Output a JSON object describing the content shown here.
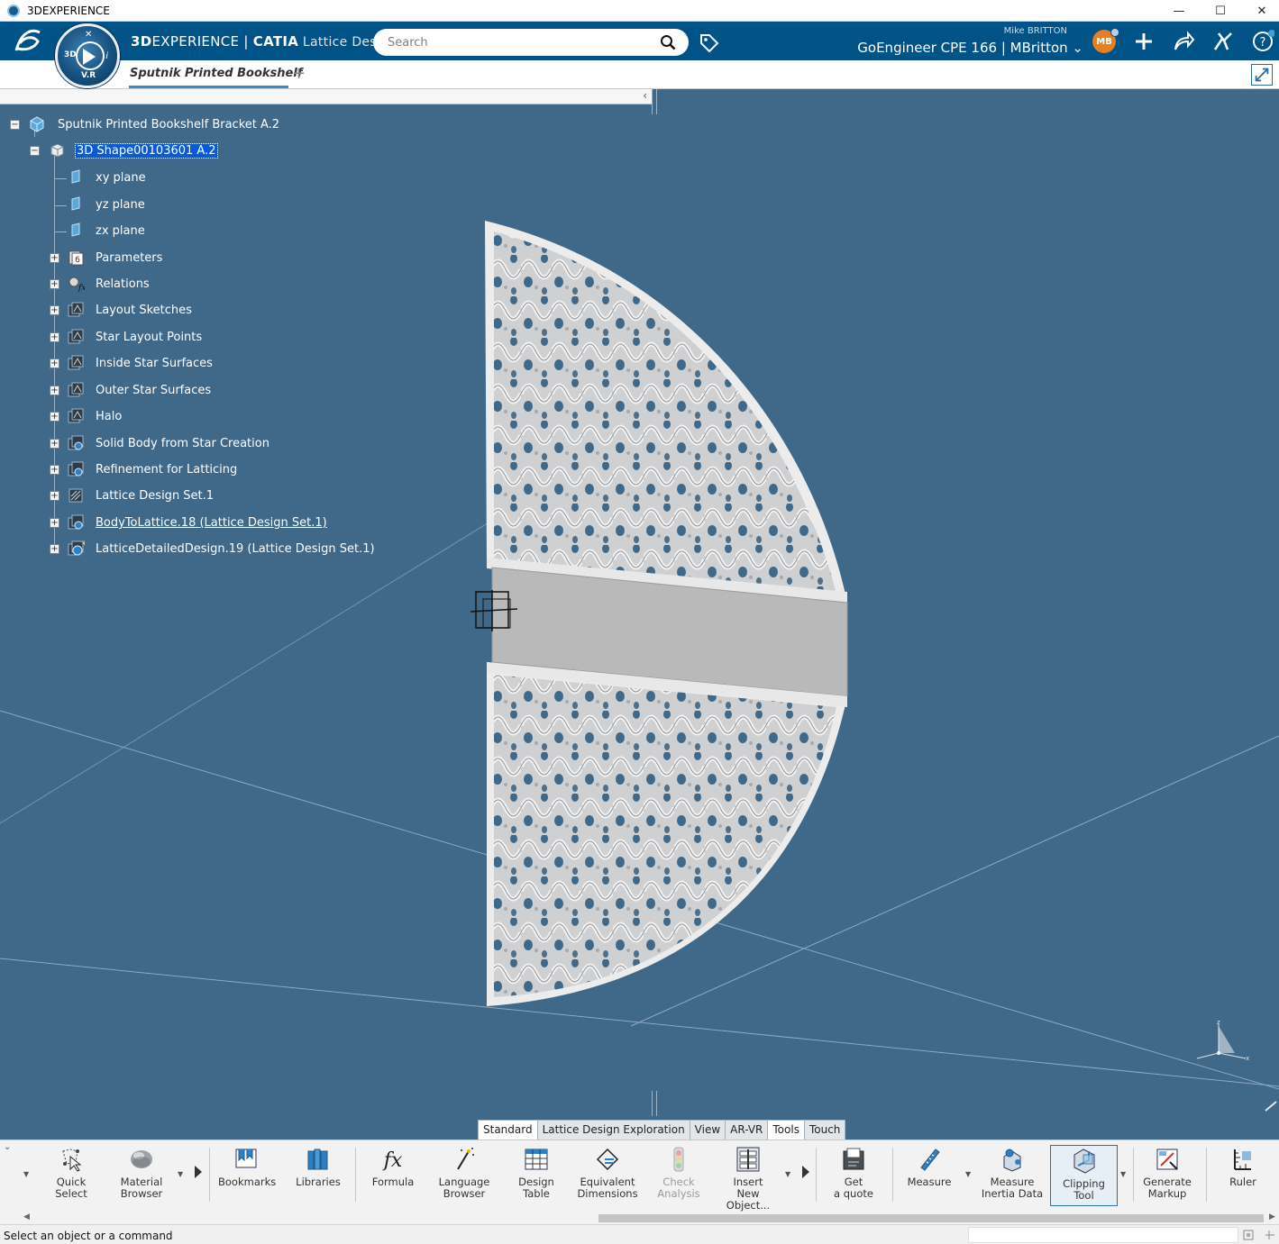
{
  "window": {
    "title": "3DEXPERIENCE",
    "minimize": "—",
    "maximize": "☐",
    "close": "✕"
  },
  "topbar": {
    "compass_3d": "3D",
    "compass_vr": "V.R",
    "brand": "3D",
    "brand_rest": "EXPERIENCE",
    "separator": " | ",
    "product": "CATIA",
    "app": " Lattice Design",
    "search_placeholder": "Search",
    "user_name": "Mike BRITTON",
    "tenant": "GoEngineer CPE 166 | MBritton ⌄",
    "avatar_initials": "MB"
  },
  "tabs": {
    "active": "Sputnik Printed Bookshelf",
    "add": "+"
  },
  "tree": {
    "collapse": "‹",
    "nodes": [
      {
        "label": "Sputnik Printed Bookshelf Bracket A.2",
        "icon": "product-icon"
      },
      {
        "label": "3D Shape00103601 A.2",
        "icon": "part-icon",
        "selected": true
      },
      {
        "label": "xy plane",
        "icon": "plane-icon"
      },
      {
        "label": "yz plane",
        "icon": "plane-icon"
      },
      {
        "label": "zx plane",
        "icon": "plane-icon"
      },
      {
        "label": "Parameters",
        "icon": "parameters-icon"
      },
      {
        "label": "Relations",
        "icon": "relations-icon"
      },
      {
        "label": "Layout Sketches",
        "icon": "geometrical-set-icon"
      },
      {
        "label": "Star Layout Points",
        "icon": "geometrical-set-icon"
      },
      {
        "label": "Inside Star Surfaces",
        "icon": "geometrical-set-icon"
      },
      {
        "label": "Outer Star Surfaces",
        "icon": "geometrical-set-icon"
      },
      {
        "label": "Halo",
        "icon": "geometrical-set-icon"
      },
      {
        "label": "Solid Body from Star Creation",
        "icon": "body-icon"
      },
      {
        "label": "Refinement for Latticing",
        "icon": "body-icon"
      },
      {
        "label": "Lattice Design Set.1",
        "icon": "lattice-set-icon"
      },
      {
        "label": "BodyToLattice.18 (Lattice Design Set.1)",
        "icon": "body-to-lattice-icon",
        "underline": true
      },
      {
        "label": "LatticeDetailedDesign.19 (Lattice Design Set.1)",
        "icon": "lattice-detailed-icon"
      }
    ]
  },
  "section_tabs": [
    "Standard",
    "Lattice Design Exploration",
    "View",
    "AR-VR",
    "Tools",
    "Touch"
  ],
  "actions": [
    {
      "name": "quick-select",
      "label1": "Quick",
      "label2": "Select",
      "icon": "quick-select-icon"
    },
    {
      "name": "material-browser",
      "label1": "Material",
      "label2": "Browser",
      "icon": "material-browser-icon"
    },
    {
      "name": "bookmarks",
      "label1": "Bookmarks",
      "label2": "",
      "icon": "bookmarks-icon"
    },
    {
      "name": "libraries",
      "label1": "Libraries",
      "label2": "",
      "icon": "libraries-icon"
    },
    {
      "name": "formula",
      "label1": "Formula",
      "label2": "",
      "icon": "formula-icon"
    },
    {
      "name": "language-browser",
      "label1": "Language",
      "label2": "Browser",
      "icon": "language-browser-icon"
    },
    {
      "name": "design-table",
      "label1": "Design",
      "label2": "Table",
      "icon": "design-table-icon"
    },
    {
      "name": "equivalent-dimensions",
      "label1": "Equivalent",
      "label2": "Dimensions",
      "icon": "equivalent-dimensions-icon"
    },
    {
      "name": "check-analysis",
      "label1": "Check",
      "label2": "Analysis",
      "icon": "check-analysis-icon",
      "disabled": true
    },
    {
      "name": "insert-new-object",
      "label1": "Insert",
      "label2": "New Object...",
      "icon": "insert-object-icon"
    },
    {
      "name": "get-a-quote",
      "label1": "Get",
      "label2": "a quote",
      "icon": "quote-icon"
    },
    {
      "name": "measure",
      "label1": "Measure",
      "label2": "",
      "icon": "measure-icon"
    },
    {
      "name": "measure-inertia-data",
      "label1": "Measure",
      "label2": "Inertia Data",
      "icon": "inertia-icon"
    },
    {
      "name": "clipping-tool",
      "label1": "Clipping",
      "label2": "Tool",
      "icon": "clipping-icon",
      "active": true
    },
    {
      "name": "generate-markup",
      "label1": "Generate",
      "label2": "Markup",
      "icon": "markup-icon"
    },
    {
      "name": "ruler",
      "label1": "Ruler",
      "label2": "",
      "icon": "ruler-icon"
    }
  ],
  "status": {
    "text": "Select an object or a command"
  },
  "colors": {
    "topbar": "#005386",
    "viewport": "#3f6889",
    "selection": "#0a5ad6",
    "accent": "#368ec4",
    "avatar": "#e67e22"
  }
}
